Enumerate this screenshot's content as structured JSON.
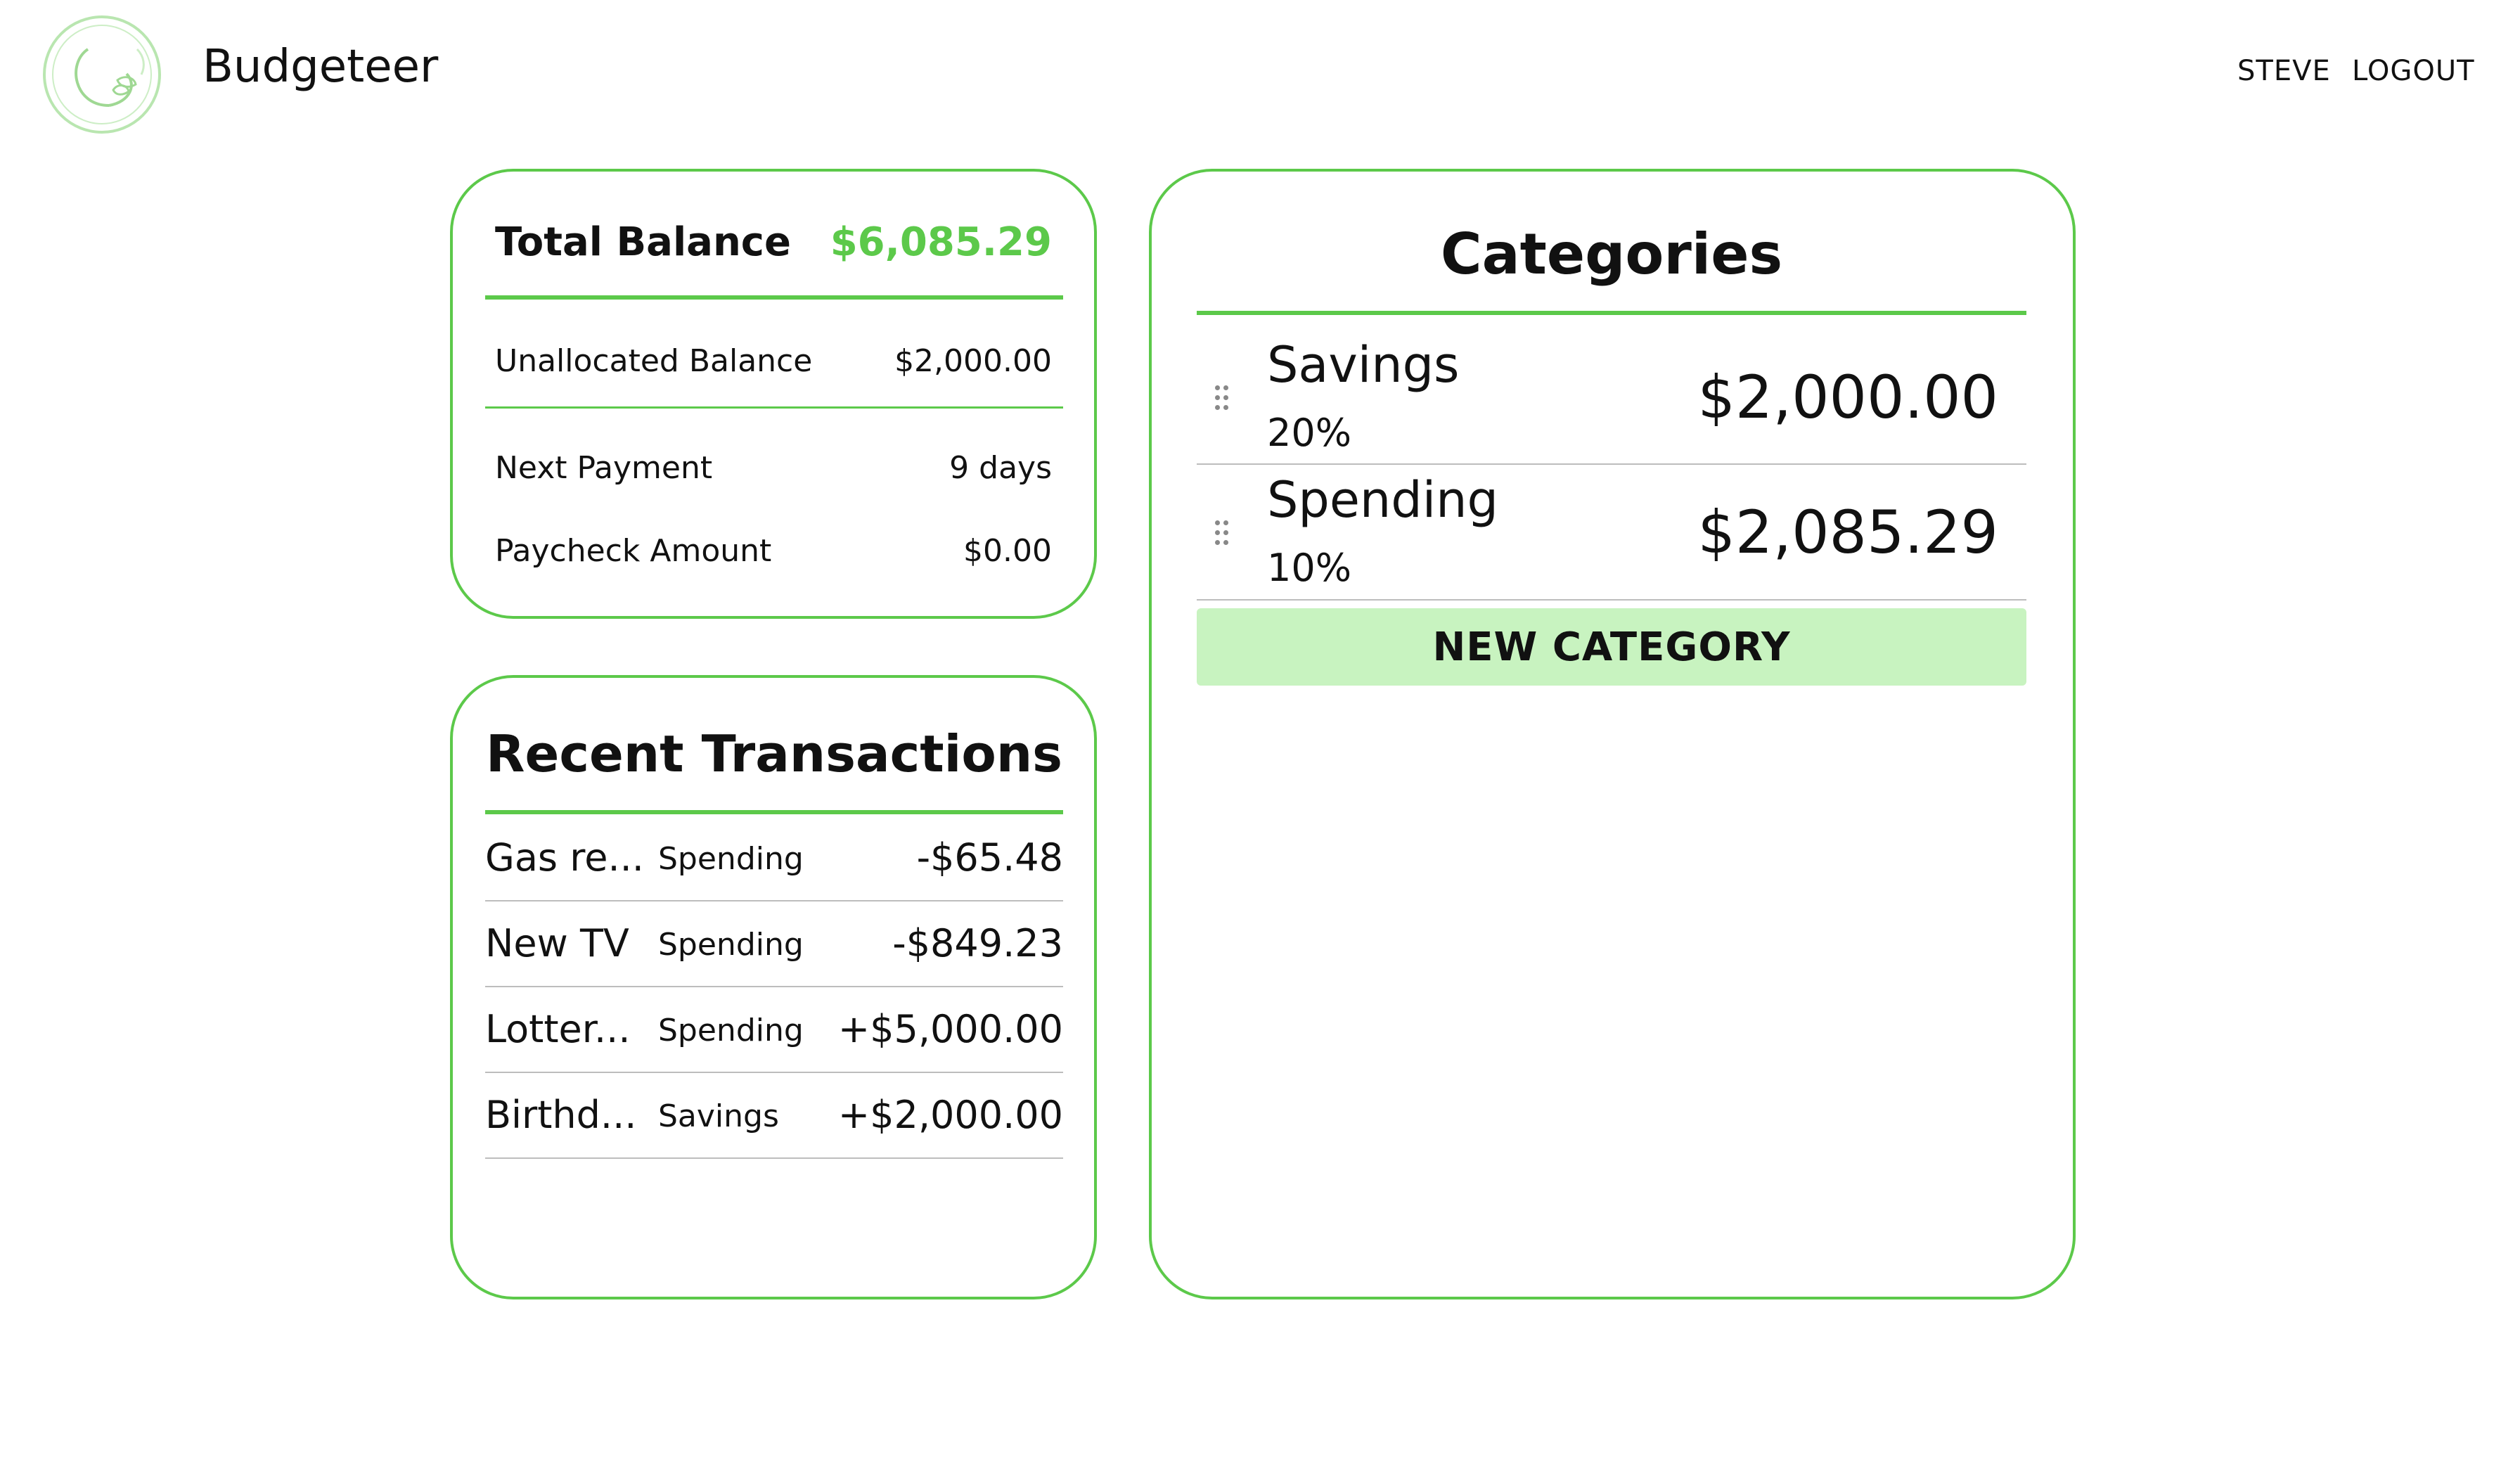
{
  "header": {
    "brand": "Budgeteer",
    "user_label": "STEVE",
    "logout_label": "LOGOUT",
    "logo_icon": "leaf-circle-logo-icon"
  },
  "balance": {
    "total_label": "Total Balance",
    "total_value": "$6,085.29",
    "unallocated_label": "Unallocated Balance",
    "unallocated_value": "$2,000.00",
    "next_payment_label": "Next Payment",
    "next_payment_value": "9 days",
    "paycheck_label": "Paycheck Amount",
    "paycheck_value": "$0.00"
  },
  "transactions": {
    "title": "Recent Transactions",
    "items": [
      {
        "name": "Gas re...",
        "category": "Spending",
        "amount": "-$65.48"
      },
      {
        "name": "New TV",
        "category": "Spending",
        "amount": "-$849.23"
      },
      {
        "name": "Lotter...",
        "category": "Spending",
        "amount": "+$5,000.00"
      },
      {
        "name": "Birthd...",
        "category": "Savings",
        "amount": "+$2,000.00"
      }
    ]
  },
  "categories": {
    "title": "Categories",
    "items": [
      {
        "name": "Savings",
        "percent": "20%",
        "amount": "$2,000.00",
        "drag_icon": "drag-handle-icon"
      },
      {
        "name": "Spending",
        "percent": "10%",
        "amount": "$2,085.29",
        "drag_icon": "drag-handle-icon"
      }
    ],
    "new_button_label": "NEW CATEGORY"
  },
  "colors": {
    "accent": "#5cc94a",
    "button_bg": "#c8f3c0"
  }
}
